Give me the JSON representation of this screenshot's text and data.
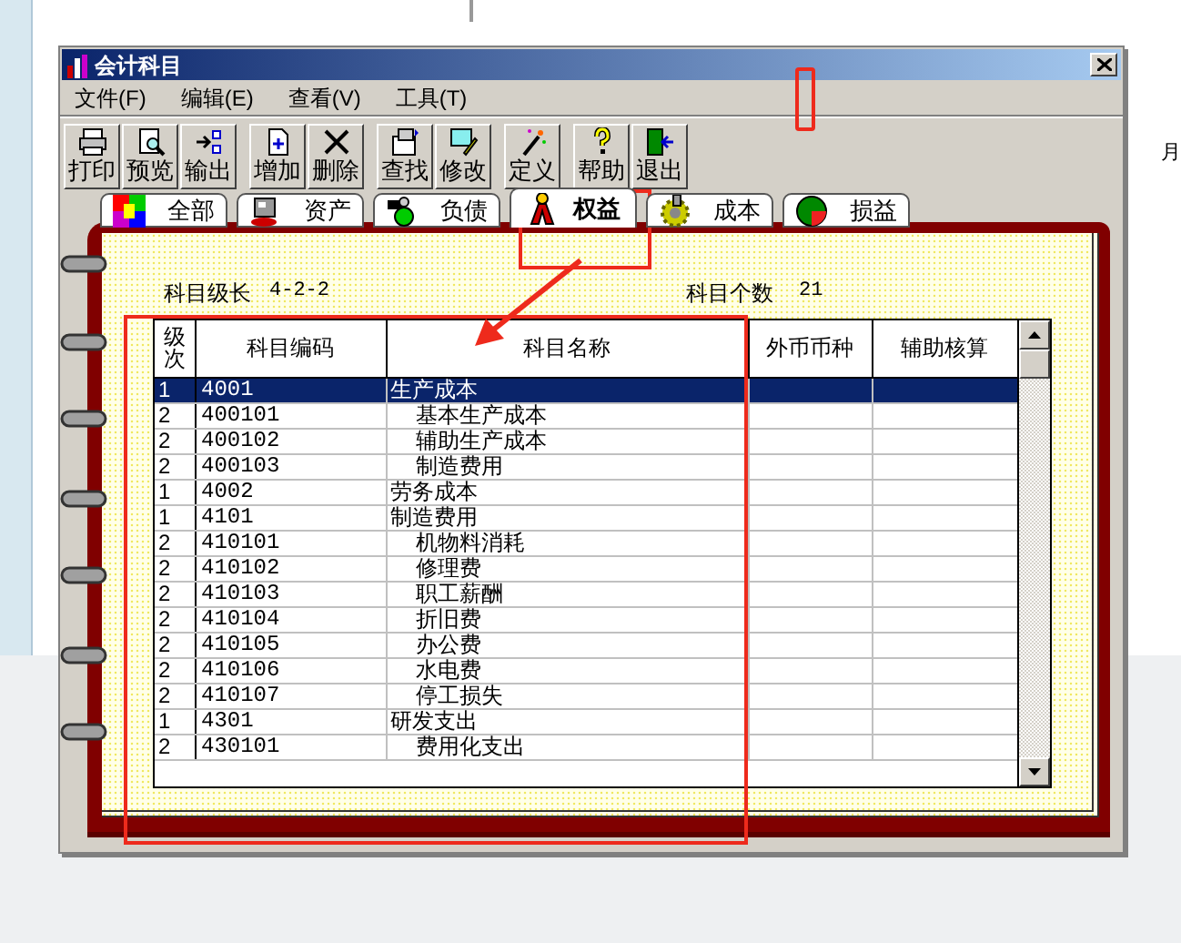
{
  "background_text": "月",
  "window": {
    "title": "会计科目"
  },
  "menu": [
    {
      "label": "文件(F)"
    },
    {
      "label": "编辑(E)"
    },
    {
      "label": "查看(V)"
    },
    {
      "label": "工具(T)"
    }
  ],
  "toolbar": [
    {
      "kind": "print",
      "label": "打印"
    },
    {
      "kind": "preview",
      "label": "预览"
    },
    {
      "kind": "export",
      "label": "输出"
    },
    {
      "kind": "separator"
    },
    {
      "kind": "add",
      "label": "增加"
    },
    {
      "kind": "delete",
      "label": "删除"
    },
    {
      "kind": "separator"
    },
    {
      "kind": "find",
      "label": "查找"
    },
    {
      "kind": "edit",
      "label": "修改"
    },
    {
      "kind": "separator"
    },
    {
      "kind": "define",
      "label": "定义"
    },
    {
      "kind": "separator"
    },
    {
      "kind": "help",
      "label": "帮助"
    },
    {
      "kind": "exit",
      "label": "退出"
    }
  ],
  "tabs": [
    {
      "kind": "all",
      "label": "全部",
      "selected": false
    },
    {
      "kind": "assets",
      "label": "资产",
      "selected": false
    },
    {
      "kind": "liabilities",
      "label": "负债",
      "selected": false
    },
    {
      "kind": "equity",
      "label": "权益",
      "selected": true
    },
    {
      "kind": "cost",
      "label": "成本",
      "selected": false
    },
    {
      "kind": "profit",
      "label": "损益",
      "selected": false
    }
  ],
  "info": {
    "code_length_label": "科目级长",
    "code_length": "4-2-2",
    "count_label": "科目个数",
    "count": "21"
  },
  "table": {
    "columns": [
      "级次",
      "科目编码",
      "科目名称",
      "外币币种",
      "辅助核算"
    ],
    "rows": [
      {
        "level": "1",
        "code": "4001",
        "name": "生产成本",
        "selected": true,
        "children": [
          {
            "level": "2",
            "code": "400101",
            "name": "基本生产成本",
            "selected": false
          },
          {
            "level": "2",
            "code": "400102",
            "name": "辅助生产成本",
            "selected": false
          },
          {
            "level": "2",
            "code": "400103",
            "name": "制造费用",
            "selected": false
          }
        ]
      },
      {
        "level": "1",
        "code": "4002",
        "name": "劳务成本",
        "selected": false
      },
      {
        "level": "1",
        "code": "4101",
        "name": "制造费用",
        "selected": false,
        "children": [
          {
            "level": "2",
            "code": "410101",
            "name": "机物料消耗",
            "selected": false
          },
          {
            "level": "2",
            "code": "410102",
            "name": "修理费",
            "selected": false
          },
          {
            "level": "2",
            "code": "410103",
            "name": "职工薪酬",
            "selected": false
          },
          {
            "level": "2",
            "code": "410104",
            "name": "折旧费",
            "selected": false
          },
          {
            "level": "2",
            "code": "410105",
            "name": "办公费",
            "selected": false
          },
          {
            "level": "2",
            "code": "410106",
            "name": "水电费",
            "selected": false
          },
          {
            "level": "2",
            "code": "410107",
            "name": "停工损失",
            "selected": false
          }
        ]
      },
      {
        "level": "1",
        "code": "4301",
        "name": "研发支出",
        "selected": false,
        "children": [
          {
            "level": "2",
            "code": "430101",
            "name": "费用化支出",
            "selected": false
          }
        ]
      }
    ]
  }
}
